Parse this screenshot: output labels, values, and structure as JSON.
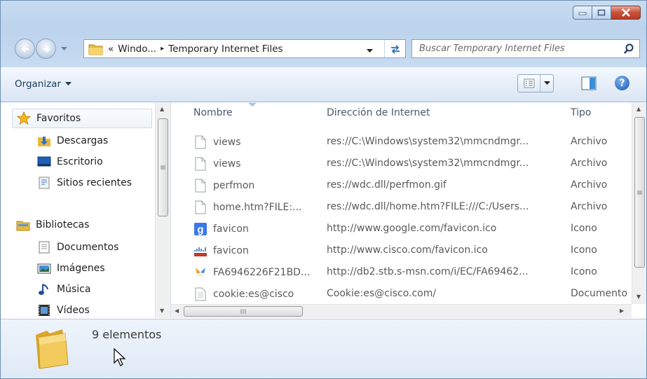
{
  "window": {
    "caption_buttons": [
      "minimize",
      "maximize",
      "close"
    ]
  },
  "navigation": {
    "address": {
      "crumb_prefix": "«",
      "crumb_1": "Windo...",
      "crumb_sep": "▸",
      "crumb_2": "Temporary Internet Files"
    },
    "search": {
      "placeholder": "Buscar Temporary Internet Files"
    }
  },
  "toolbar": {
    "organize_label": "Organizar"
  },
  "nav_pane": {
    "favorites_label": "Favoritos",
    "favorites": [
      {
        "label": "Descargas",
        "icon": "downloads-icon"
      },
      {
        "label": "Escritorio",
        "icon": "desktop-icon"
      },
      {
        "label": "Sitios recientes",
        "icon": "recent-places-icon"
      }
    ],
    "libraries_label": "Bibliotecas",
    "libraries": [
      {
        "label": "Documentos",
        "icon": "documents-icon"
      },
      {
        "label": "Imágenes",
        "icon": "pictures-icon"
      },
      {
        "label": "Música",
        "icon": "music-icon"
      },
      {
        "label": "Vídeos",
        "icon": "videos-icon"
      }
    ]
  },
  "file_list": {
    "columns": [
      "Nombre",
      "Dirección de Internet",
      "Tipo"
    ],
    "rows": [
      {
        "name": "views",
        "address": "res://C:\\Windows\\system32\\mmcndmgr...",
        "type": "Archivo",
        "icon": "blank-file-icon"
      },
      {
        "name": "views",
        "address": "res://C:\\Windows\\system32\\mmcndmgr...",
        "type": "Archivo",
        "icon": "blank-file-icon"
      },
      {
        "name": "perfmon",
        "address": "res://wdc.dll/perfmon.gif",
        "type": "Archivo",
        "icon": "blank-file-icon"
      },
      {
        "name": "home.htm?FILE:...",
        "address": "res://wdc.dll/home.htm?FILE:///C:/Users...",
        "type": "Archivo",
        "icon": "blank-file-icon"
      },
      {
        "name": "favicon",
        "address": "http://www.google.com/favicon.ico",
        "type": "Icono",
        "icon": "google-favicon-icon"
      },
      {
        "name": "favicon",
        "address": "http://www.cisco.com/favicon.ico",
        "type": "Icono",
        "icon": "cisco-favicon-icon"
      },
      {
        "name": "FA6946226F21BD...",
        "address": "http://db2.stb.s-msn.com/i/EC/FA69462...",
        "type": "Icono",
        "icon": "msn-butterfly-icon"
      },
      {
        "name": "cookie:es@cisco",
        "address": "Cookie:es@cisco.com/",
        "type": "Documento",
        "icon": "text-file-icon"
      }
    ]
  },
  "details_pane": {
    "item_count": "9 elementos"
  },
  "colors": {
    "frame": "#bcd3ec",
    "accent": "#1a5bb5",
    "close": "#c8503b"
  }
}
